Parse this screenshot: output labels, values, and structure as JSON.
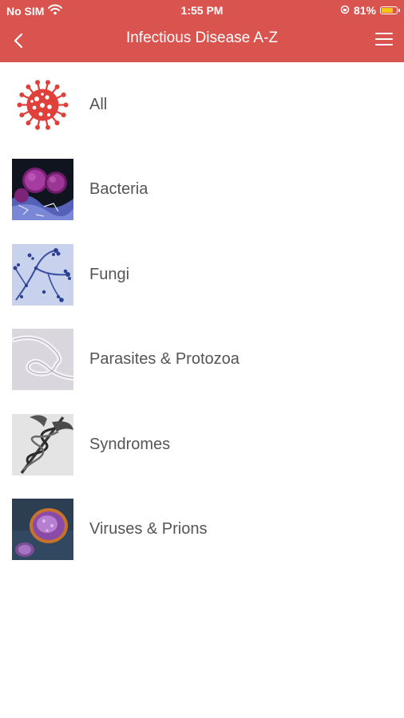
{
  "status_bar": {
    "carrier": "No SIM",
    "time": "1:55 PM",
    "battery_percent": "81%",
    "battery_level": 0.81
  },
  "nav": {
    "title": "Infectious Disease A-Z",
    "back_icon": "chevron-left-icon",
    "menu_icon": "hamburger-menu-icon"
  },
  "categories": [
    {
      "label": "All",
      "icon": "virus-icon"
    },
    {
      "label": "Bacteria",
      "icon": "bacteria-image"
    },
    {
      "label": "Fungi",
      "icon": "fungi-image"
    },
    {
      "label": "Parasites & Protozoa",
      "icon": "parasite-image"
    },
    {
      "label": "Syndromes",
      "icon": "caduceus-image"
    },
    {
      "label": "Viruses & Prions",
      "icon": "virus-particle-image"
    }
  ],
  "colors": {
    "header": "#d9534f",
    "label_text": "#555555"
  }
}
